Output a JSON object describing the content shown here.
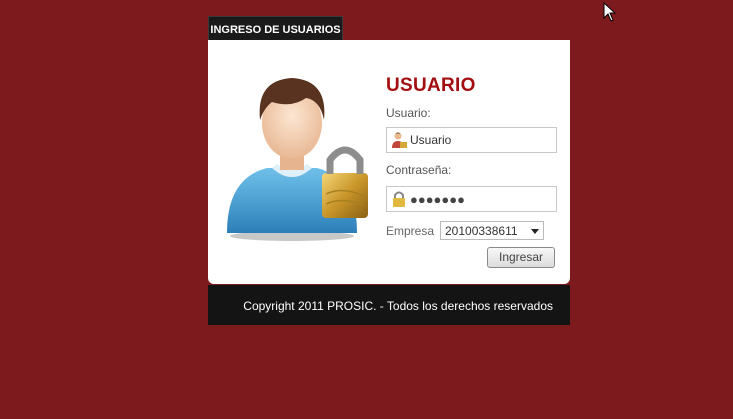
{
  "tab": {
    "label": "INGRESO DE USUARIOS"
  },
  "form": {
    "heading": "USUARIO",
    "user_label": "Usuario:",
    "user_value": "Usuario",
    "password_label": "Contraseña:",
    "password_value": "●●●●●●●",
    "company_label": "Empresa",
    "company_selected": "20100338611",
    "submit_label": "Ingresar"
  },
  "footer": {
    "text": "Copyright 2011 PROSIC. - Todos los derechos reservados"
  },
  "icons": {
    "avatar": "user-lock-icon",
    "user_field": "user-icon",
    "password_field": "lock-icon",
    "select_arrow": "chevron-down-icon",
    "cursor": "mouse-pointer-icon"
  },
  "colors": {
    "background": "#7d1a1d",
    "heading": "#a30f11",
    "tab": "#1a1a1a",
    "footer": "#141414"
  }
}
